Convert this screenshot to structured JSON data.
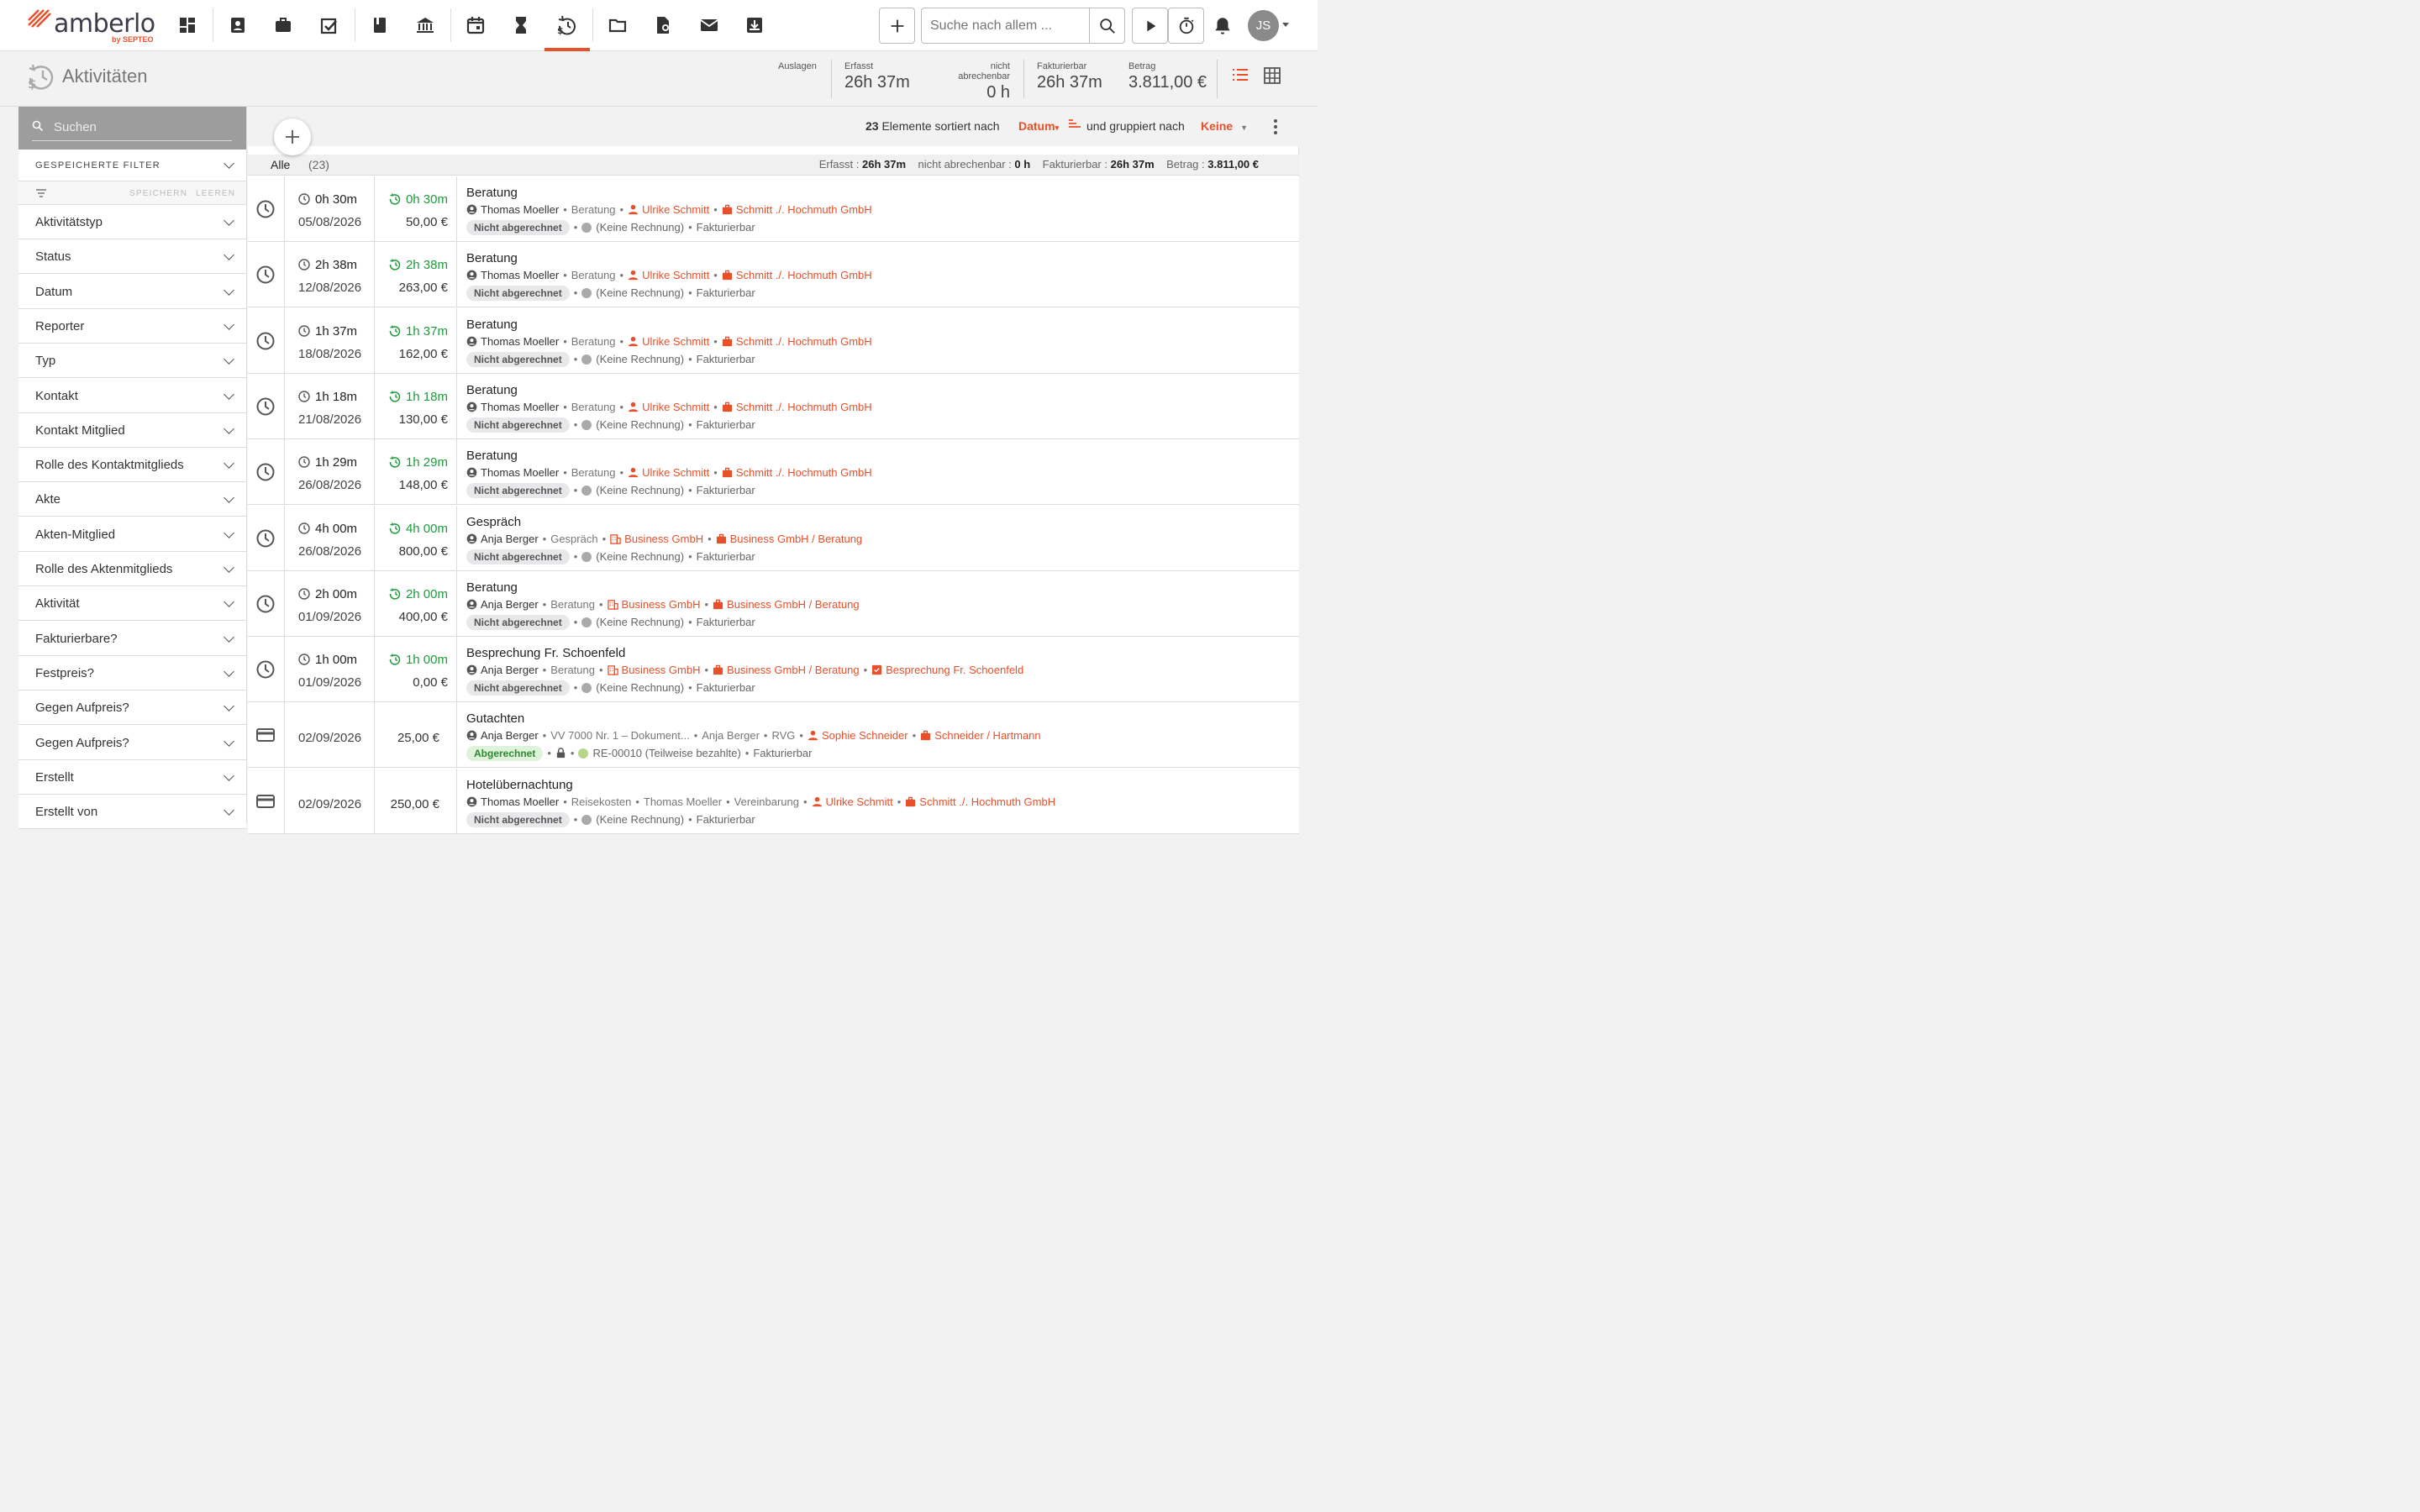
{
  "brand": {
    "name": "amberlo",
    "by": "by SEPTEO"
  },
  "nav": {
    "icons": [
      "dashboard-icon",
      "contacts-icon",
      "matters-icon",
      "tasks-icon",
      "book-icon",
      "bank-icon",
      "calendar-icon",
      "hourglass-icon",
      "time-billing-icon",
      "folder-icon",
      "document-award-icon",
      "mail-icon",
      "inbox-download-icon"
    ],
    "active": "time-billing-icon"
  },
  "search": {
    "placeholder": "Suche nach allem ..."
  },
  "user": {
    "initials": "JS"
  },
  "page": {
    "title": "Aktivitäten"
  },
  "stats": [
    {
      "label": "Auslagen",
      "value": ""
    },
    {
      "label": "Erfasst",
      "value": "26h 37m"
    },
    {
      "label": "nicht abrechenbar",
      "value": "0 h"
    },
    {
      "label": "Fakturierbar",
      "value": "26h 37m"
    },
    {
      "label": "Betrag",
      "value": "3.811,00 €"
    }
  ],
  "sidebar": {
    "search_placeholder": "Suchen",
    "saved_filters": "GESPEICHERTE FILTER",
    "save": "SPEICHERN",
    "clear": "LEEREN",
    "filters": [
      "Aktivitätstyp",
      "Status",
      "Datum",
      "Reporter",
      "Typ",
      "Kontakt",
      "Kontakt Mitglied",
      "Rolle des Kontaktmitglieds",
      "Akte",
      "Akten-Mitglied",
      "Rolle des Aktenmitglieds",
      "Aktivität",
      "Fakturierbare?",
      "Festpreis?",
      "Gegen Aufpreis?",
      "Gegen Aufpreis?",
      "Erstellt",
      "Erstellt von"
    ]
  },
  "listhead": {
    "count": "23",
    "sorted_by_label": "Elemente sortiert nach",
    "sort_value": "Datum",
    "grouped_by_label": "und gruppiert nach",
    "group_value": "Keine"
  },
  "summary": {
    "all_label": "Alle",
    "all_count": "(23)",
    "erfasst_label": "Erfasst :",
    "erfasst": "26h 37m",
    "nab_label": "nicht abrechenbar :",
    "nab": "0 h",
    "fakt_label": "Fakturierbar :",
    "fakt": "26h 37m",
    "betrag_label": "Betrag :",
    "betrag": "3.811,00 €"
  },
  "rows": [
    {
      "kind": "time",
      "dur": "0h 30m",
      "date": "05/08/2026",
      "bill": "0h 30m",
      "amount": "50,00 €",
      "title": "Beratung",
      "meta": [
        {
          "t": "who",
          "v": "Thomas Moeller"
        },
        {
          "t": "txt",
          "v": "Beratung"
        },
        {
          "t": "person",
          "v": "Ulrike Schmitt"
        },
        {
          "t": "matter",
          "v": "Schmitt ./. Hochmuth GmbH"
        }
      ],
      "badge": "Nicht abgerechnet",
      "invoice": "(Keine Rechnung)",
      "billable": "Fakturierbar"
    },
    {
      "kind": "time",
      "dur": "2h 38m",
      "date": "12/08/2026",
      "bill": "2h 38m",
      "amount": "263,00 €",
      "title": "Beratung",
      "meta": [
        {
          "t": "who",
          "v": "Thomas Moeller"
        },
        {
          "t": "txt",
          "v": "Beratung"
        },
        {
          "t": "person",
          "v": "Ulrike Schmitt"
        },
        {
          "t": "matter",
          "v": "Schmitt ./. Hochmuth GmbH"
        }
      ],
      "badge": "Nicht abgerechnet",
      "invoice": "(Keine Rechnung)",
      "billable": "Fakturierbar"
    },
    {
      "kind": "time",
      "dur": "1h 37m",
      "date": "18/08/2026",
      "bill": "1h 37m",
      "amount": "162,00 €",
      "title": "Beratung",
      "meta": [
        {
          "t": "who",
          "v": "Thomas Moeller"
        },
        {
          "t": "txt",
          "v": "Beratung"
        },
        {
          "t": "person",
          "v": "Ulrike Schmitt"
        },
        {
          "t": "matter",
          "v": "Schmitt ./. Hochmuth GmbH"
        }
      ],
      "badge": "Nicht abgerechnet",
      "invoice": "(Keine Rechnung)",
      "billable": "Fakturierbar"
    },
    {
      "kind": "time",
      "dur": "1h 18m",
      "date": "21/08/2026",
      "bill": "1h 18m",
      "amount": "130,00 €",
      "title": "Beratung",
      "meta": [
        {
          "t": "who",
          "v": "Thomas Moeller"
        },
        {
          "t": "txt",
          "v": "Beratung"
        },
        {
          "t": "person",
          "v": "Ulrike Schmitt"
        },
        {
          "t": "matter",
          "v": "Schmitt ./. Hochmuth GmbH"
        }
      ],
      "badge": "Nicht abgerechnet",
      "invoice": "(Keine Rechnung)",
      "billable": "Fakturierbar"
    },
    {
      "kind": "time",
      "dur": "1h 29m",
      "date": "26/08/2026",
      "bill": "1h 29m",
      "amount": "148,00 €",
      "title": "Beratung",
      "meta": [
        {
          "t": "who",
          "v": "Thomas Moeller"
        },
        {
          "t": "txt",
          "v": "Beratung"
        },
        {
          "t": "person",
          "v": "Ulrike Schmitt"
        },
        {
          "t": "matter",
          "v": "Schmitt ./. Hochmuth GmbH"
        }
      ],
      "badge": "Nicht abgerechnet",
      "invoice": "(Keine Rechnung)",
      "billable": "Fakturierbar"
    },
    {
      "kind": "time",
      "dur": "4h 00m",
      "date": "26/08/2026",
      "bill": "4h 00m",
      "amount": "800,00 €",
      "title": "Gespräch",
      "meta": [
        {
          "t": "who",
          "v": "Anja Berger"
        },
        {
          "t": "txt",
          "v": "Gespräch"
        },
        {
          "t": "org",
          "v": "Business GmbH"
        },
        {
          "t": "matter",
          "v": "Business GmbH / Beratung"
        }
      ],
      "badge": "Nicht abgerechnet",
      "invoice": "(Keine Rechnung)",
      "billable": "Fakturierbar"
    },
    {
      "kind": "time",
      "dur": "2h 00m",
      "date": "01/09/2026",
      "bill": "2h 00m",
      "amount": "400,00 €",
      "title": "Beratung",
      "meta": [
        {
          "t": "who",
          "v": "Anja Berger"
        },
        {
          "t": "txt",
          "v": "Beratung"
        },
        {
          "t": "org",
          "v": "Business GmbH"
        },
        {
          "t": "matter",
          "v": "Business GmbH / Beratung"
        }
      ],
      "badge": "Nicht abgerechnet",
      "invoice": "(Keine Rechnung)",
      "billable": "Fakturierbar"
    },
    {
      "kind": "time",
      "dur": "1h 00m",
      "date": "01/09/2026",
      "bill": "1h 00m",
      "amount": "0,00 €",
      "title": "Besprechung Fr. Schoenfeld",
      "meta": [
        {
          "t": "who",
          "v": "Anja Berger"
        },
        {
          "t": "txt",
          "v": "Beratung"
        },
        {
          "t": "org",
          "v": "Business GmbH"
        },
        {
          "t": "matter",
          "v": "Business GmbH / Beratung"
        },
        {
          "t": "task",
          "v": "Besprechung Fr. Schoenfeld"
        }
      ],
      "badge": "Nicht abgerechnet",
      "invoice": "(Keine Rechnung)",
      "billable": "Fakturierbar"
    },
    {
      "kind": "expense",
      "dur": "",
      "date": "02/09/2026",
      "bill": "",
      "amount": "25,00 €",
      "title": "Gutachten",
      "meta": [
        {
          "t": "who",
          "v": "Anja Berger"
        },
        {
          "t": "txt",
          "v": "VV 7000 Nr. 1 – Dokument..."
        },
        {
          "t": "txt",
          "v": "Anja Berger"
        },
        {
          "t": "txt",
          "v": "RVG"
        },
        {
          "t": "person",
          "v": "Sophie Schneider"
        },
        {
          "t": "matter",
          "v": "Schneider / Hartmann"
        }
      ],
      "badge": "Abgerechnet",
      "invoice": "RE-00010 (Teilweise bezahlte)",
      "billable": "Fakturierbar",
      "locked": true
    },
    {
      "kind": "expense",
      "dur": "",
      "date": "02/09/2026",
      "bill": "",
      "amount": "250,00 €",
      "title": "Hotelübernachtung",
      "meta": [
        {
          "t": "who",
          "v": "Thomas Moeller"
        },
        {
          "t": "txt",
          "v": "Reisekosten"
        },
        {
          "t": "txt",
          "v": "Thomas Moeller"
        },
        {
          "t": "txt",
          "v": "Vereinbarung"
        },
        {
          "t": "person",
          "v": "Ulrike Schmitt"
        },
        {
          "t": "matter",
          "v": "Schmitt ./. Hochmuth GmbH"
        }
      ],
      "badge": "Nicht abgerechnet",
      "invoice": "(Keine Rechnung)",
      "billable": "Fakturierbar"
    }
  ]
}
